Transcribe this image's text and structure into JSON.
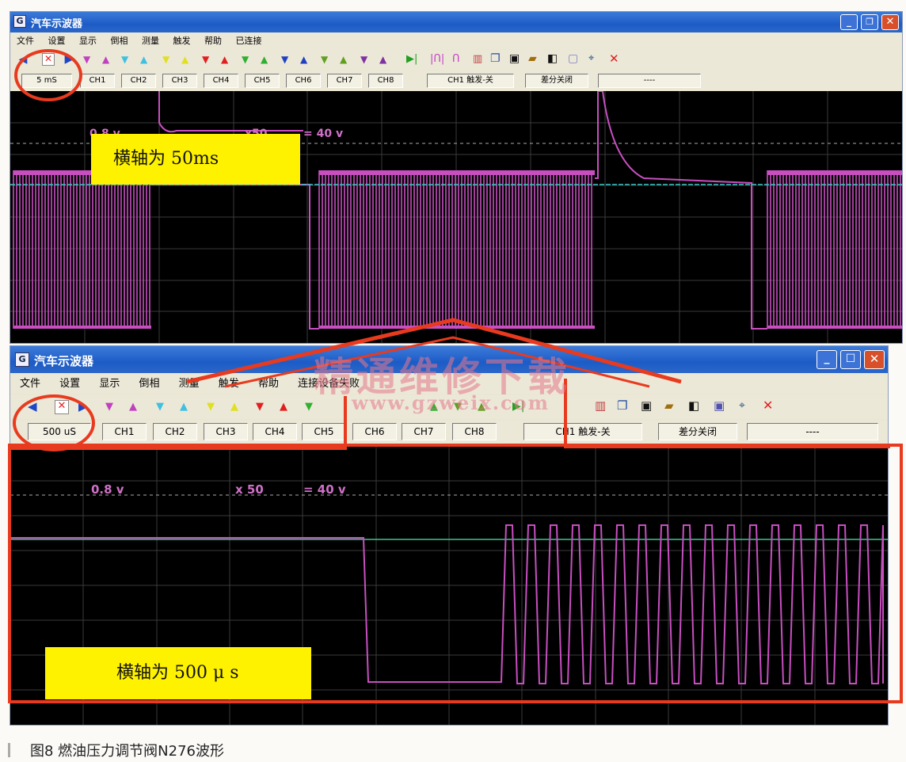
{
  "window1": {
    "title": "汽车示波器",
    "menu": [
      "文件",
      "设置",
      "显示",
      "倒相",
      "测量",
      "触发",
      "帮助",
      "已连接"
    ],
    "timebase": "5 mS",
    "channels": [
      "CH1",
      "CH2",
      "CH3",
      "CH4",
      "CH5",
      "CH6",
      "CH7",
      "CH8"
    ],
    "trigger": "CH1 触发-关",
    "diff": "差分关闭",
    "status": "----",
    "readouts": {
      "volts": "0.8 v",
      "mult": "x50",
      "range": "= 40 v"
    },
    "axis_label": "横轴为 50ms"
  },
  "window2": {
    "title": "汽车示波器",
    "menu": [
      "文件",
      "设置",
      "显示",
      "倒相",
      "测量",
      "触发",
      "帮助",
      "连接设备失败"
    ],
    "timebase": "500 uS",
    "channels": [
      "CH1",
      "CH2",
      "CH3",
      "CH4",
      "CH5",
      "CH6",
      "CH7",
      "CH8"
    ],
    "trigger": "CH1 触发-关",
    "diff": "差分关闭",
    "status": "----",
    "readouts": {
      "volts": "0.8 v",
      "mult": "x 50",
      "range": "= 40 v"
    },
    "axis_label": "横轴为 500 μ s"
  },
  "watermark": {
    "text": "精通维修下载",
    "url": "www.gzweix.com"
  },
  "caption": "图8   燃油压力调节阀N276波形",
  "colors": {
    "trace_pink": "#c84fc0",
    "trace_cyan": "#39c4c4",
    "trace_green": "#3cc88c",
    "annotation_red": "#e83a1e",
    "label_yellow": "#fff200",
    "title_blue": "#1d5cc7"
  }
}
